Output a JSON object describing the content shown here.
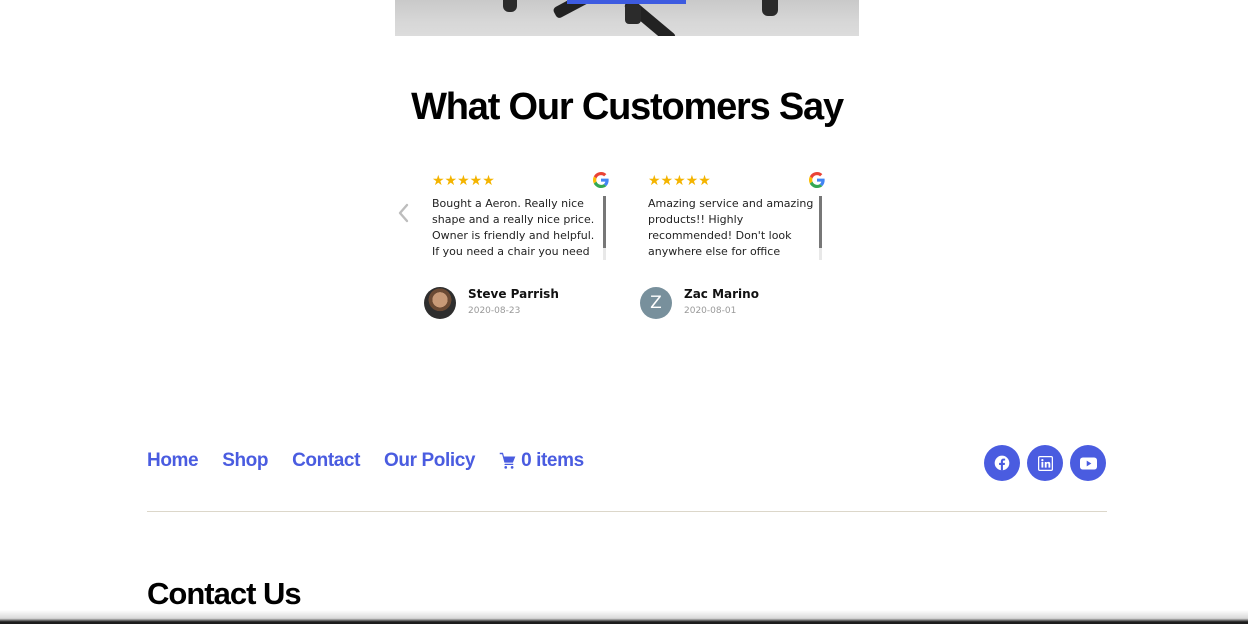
{
  "section": {
    "title": "What Our Customers Say"
  },
  "reviews": [
    {
      "stars": "★★★★★",
      "text": "Bought a Aeron. Really nice shape and a really nice price. Owner is friendly and helpful. If you need a chair you need to",
      "name": "Steve Parrish",
      "date": "2020-08-23",
      "avatar_letter": ""
    },
    {
      "stars": "★★★★★",
      "text": "Amazing service and amazing products!! Highly recommended! Don't look anywhere else for office",
      "name": "Zac Marino",
      "date": "2020-08-01",
      "avatar_letter": "Z"
    }
  ],
  "footer": {
    "nav": {
      "home": "Home",
      "shop": "Shop",
      "contact": "Contact",
      "policy": "Our Policy",
      "cart": "0 items"
    }
  },
  "contact": {
    "title": "Contact Us"
  },
  "colors": {
    "accent": "#4a5ce0",
    "star": "#f4b400",
    "divider": "#dcd7ca"
  },
  "icons": {
    "prev": "chevron-left-icon",
    "source": "google-icon",
    "cart": "cart-icon",
    "social": [
      "facebook-icon",
      "linkedin-icon",
      "youtube-icon"
    ]
  }
}
